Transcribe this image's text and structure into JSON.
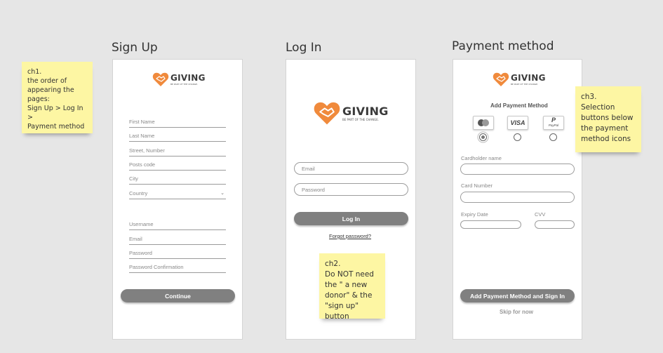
{
  "frames": {
    "signup": {
      "title": "Sign Up"
    },
    "login": {
      "title": "Log In"
    },
    "payment": {
      "title": "Payment method"
    }
  },
  "brand": {
    "name": "GIVING",
    "tagline": "BE PART OF THE CHANGE.",
    "color": "#f08a3c"
  },
  "signup": {
    "fields": [
      "First Name",
      "Last Name",
      "Street, Number",
      "Posts code",
      "City",
      "Country",
      "Username",
      "Email",
      "Password",
      "Password Confirmation"
    ],
    "continue_label": "Continue"
  },
  "login": {
    "email_placeholder": "Email",
    "password_placeholder": "Password",
    "login_label": "Log In",
    "forgot_label": "Forgot password?"
  },
  "payment": {
    "title": "Add Payment Method",
    "methods": [
      "mastercard",
      "VISA",
      "PayPal"
    ],
    "selected_method": "mastercard",
    "cardholder_label": "Cardholder name",
    "card_number_label": "Card Number",
    "expiry_label": "Expiry Date",
    "cvv_label": "CVV",
    "submit_label": "Add Payment Method and Sign In",
    "skip_label": "Skip for now"
  },
  "notes": {
    "ch1": [
      "ch1.",
      "the order of",
      "appearing the",
      "pages:",
      "Sign Up > Log In >",
      "Payment method"
    ],
    "ch2": [
      "ch2.",
      "Do NOT need",
      "the \" a new",
      "donor\" & the",
      "\"sign up\" button"
    ],
    "ch3": [
      "ch3.",
      "Selection",
      "buttons below",
      "the payment",
      "method icons"
    ]
  }
}
